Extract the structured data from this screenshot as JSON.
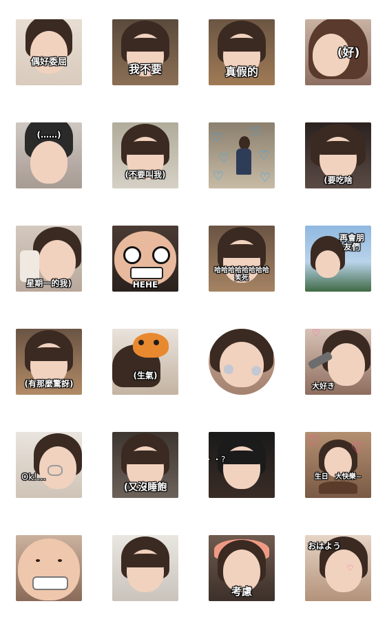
{
  "stickers": [
    {
      "caption": "偶好委屈"
    },
    {
      "caption": "我不要"
    },
    {
      "caption": "真假的"
    },
    {
      "caption": "(好)"
    },
    {
      "caption": "(……)"
    },
    {
      "caption": "(不要叫我)"
    },
    {
      "caption": ""
    },
    {
      "caption": "(要吃啥"
    },
    {
      "caption": "星期一的我)"
    },
    {
      "caption": "HEHE"
    },
    {
      "caption": "哈哈哈哈哈哈哈哈笑死"
    },
    {
      "caption": "再會朋友們"
    },
    {
      "caption": "(有那麼驚訝)"
    },
    {
      "caption": "(生氣)"
    },
    {
      "caption": ""
    },
    {
      "caption": "大好き"
    },
    {
      "caption": "Ok!…"
    },
    {
      "caption": "(又沒睡飽"
    },
    {
      "caption": "・・?"
    },
    {
      "caption": "生日　大快樂~"
    },
    {
      "caption": ""
    },
    {
      "caption": ""
    },
    {
      "caption": "考慮"
    },
    {
      "caption": "おはよう"
    }
  ],
  "colors": {
    "background": "#ffffff",
    "caption": "#ffffff",
    "heart_blue": "#2aa8ff",
    "heart_pink": "#ff4f9a"
  }
}
